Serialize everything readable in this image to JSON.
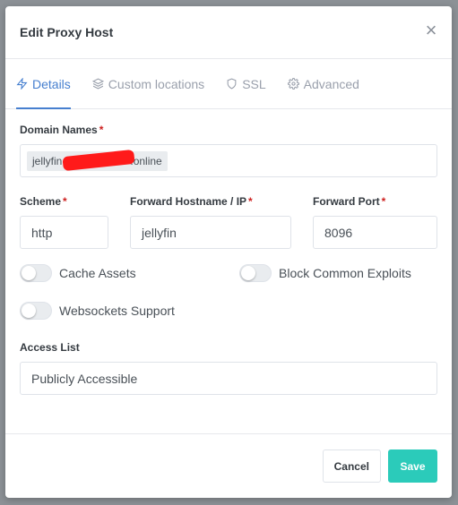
{
  "modal": {
    "title": "Edit Proxy Host"
  },
  "tabs": [
    {
      "label": "Details",
      "icon": "lightning-icon",
      "active": true
    },
    {
      "label": "Custom locations",
      "icon": "layers-icon",
      "active": false
    },
    {
      "label": "SSL",
      "icon": "shield-icon",
      "active": false
    },
    {
      "label": "Advanced",
      "icon": "gear-icon",
      "active": false
    }
  ],
  "form": {
    "domain_names_label": "Domain Names",
    "domain_tag_prefix": "jellyfin",
    "domain_tag_suffix": ".online",
    "required_mark": "*",
    "scheme_label": "Scheme",
    "scheme_value": "http",
    "forward_host_label": "Forward Hostname / IP",
    "forward_host_value": "jellyfin",
    "forward_port_label": "Forward Port",
    "forward_port_value": "8096",
    "cache_assets_label": "Cache Assets",
    "block_exploits_label": "Block Common Exploits",
    "websockets_label": "Websockets Support",
    "access_list_label": "Access List",
    "access_list_value": "Publicly Accessible"
  },
  "footer": {
    "cancel_label": "Cancel",
    "save_label": "Save"
  },
  "colors": {
    "accent": "#467fcf",
    "save": "#2bcbba",
    "required": "#cd201f"
  }
}
